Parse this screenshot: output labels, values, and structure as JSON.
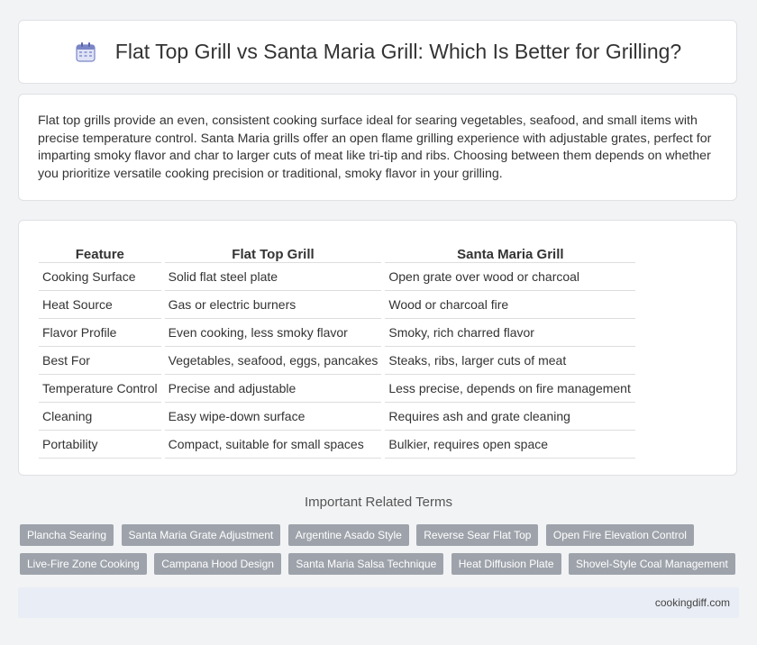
{
  "header": {
    "title": "Flat Top Grill vs Santa Maria Grill: Which Is Better for Grilling?",
    "icon": "calendar-icon"
  },
  "intro": {
    "text": "Flat top grills provide an even, consistent cooking surface ideal for searing vegetables, seafood, and small items with precise temperature control. Santa Maria grills offer an open flame grilling experience with adjustable grates, perfect for imparting smoky flavor and char to larger cuts of meat like tri-tip and ribs. Choosing between them depends on whether you prioritize versatile cooking precision or traditional, smoky flavor in your grilling."
  },
  "table": {
    "headers": [
      "Feature",
      "Flat Top Grill",
      "Santa Maria Grill"
    ],
    "rows": [
      [
        "Cooking Surface",
        "Solid flat steel plate",
        "Open grate over wood or charcoal"
      ],
      [
        "Heat Source",
        "Gas or electric burners",
        "Wood or charcoal fire"
      ],
      [
        "Flavor Profile",
        "Even cooking, less smoky flavor",
        "Smoky, rich charred flavor"
      ],
      [
        "Best For",
        "Vegetables, seafood, eggs, pancakes",
        "Steaks, ribs, larger cuts of meat"
      ],
      [
        "Temperature Control",
        "Precise and adjustable",
        "Less precise, depends on fire management"
      ],
      [
        "Cleaning",
        "Easy wipe-down surface",
        "Requires ash and grate cleaning"
      ],
      [
        "Portability",
        "Compact, suitable for small spaces",
        "Bulkier, requires open space"
      ]
    ]
  },
  "related": {
    "title": "Important Related Terms",
    "tags": [
      "Plancha Searing",
      "Santa Maria Grate Adjustment",
      "Argentine Asado Style",
      "Reverse Sear Flat Top",
      "Open Fire Elevation Control",
      "Live-Fire Zone Cooking",
      "Campana Hood Design",
      "Santa Maria Salsa Technique",
      "Heat Diffusion Plate",
      "Shovel-Style Coal Management"
    ]
  },
  "footer": {
    "site": "cookingdiff.com"
  }
}
